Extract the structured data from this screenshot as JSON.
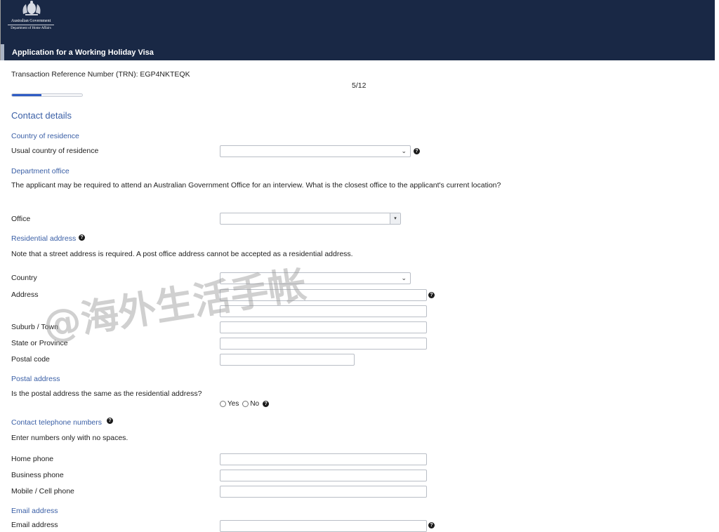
{
  "header": {
    "gov_name": "Australian Government",
    "department": "Department of Home Affairs",
    "app_title": "Application for a Working Holiday Visa"
  },
  "trn": "Transaction Reference Number (TRN): EGP4NKTEQK",
  "progress": {
    "label": "5/12",
    "step": 5,
    "total": 12
  },
  "page_heading": "Contact details",
  "country_of_residence": {
    "heading": "Country of residence",
    "label": "Usual country of residence",
    "value": ""
  },
  "department_office": {
    "heading": "Department office",
    "question": "The applicant may be required to attend an Australian Government Office for an interview. What is the closest office to the applicant's current location?",
    "office_label": "Office",
    "office_value": ""
  },
  "residential_address": {
    "heading": "Residential address",
    "note": "Note that a street address is required. A post office address cannot be accepted as a residential address.",
    "country_label": "Country",
    "address_label": "Address",
    "suburb_label": "Suburb / Town",
    "state_label": "State or Province",
    "postal_label": "Postal code"
  },
  "postal_address": {
    "heading": "Postal address",
    "question": "Is the postal address the same as the residential address?",
    "yes": "Yes",
    "no": "No"
  },
  "telephone": {
    "heading": "Contact telephone numbers",
    "note": "Enter numbers only with no spaces.",
    "home_label": "Home phone",
    "business_label": "Business phone",
    "mobile_label": "Mobile / Cell phone"
  },
  "email": {
    "heading": "Email address",
    "label": "Email address"
  },
  "icons": {
    "help": "?",
    "chevron": "⌄",
    "select_arrow": "▾"
  },
  "watermark": "@海外生活手帐",
  "colors": {
    "header_bg": "#192845",
    "heading": "#3a5fa6",
    "progress": "#2f5cc4"
  }
}
